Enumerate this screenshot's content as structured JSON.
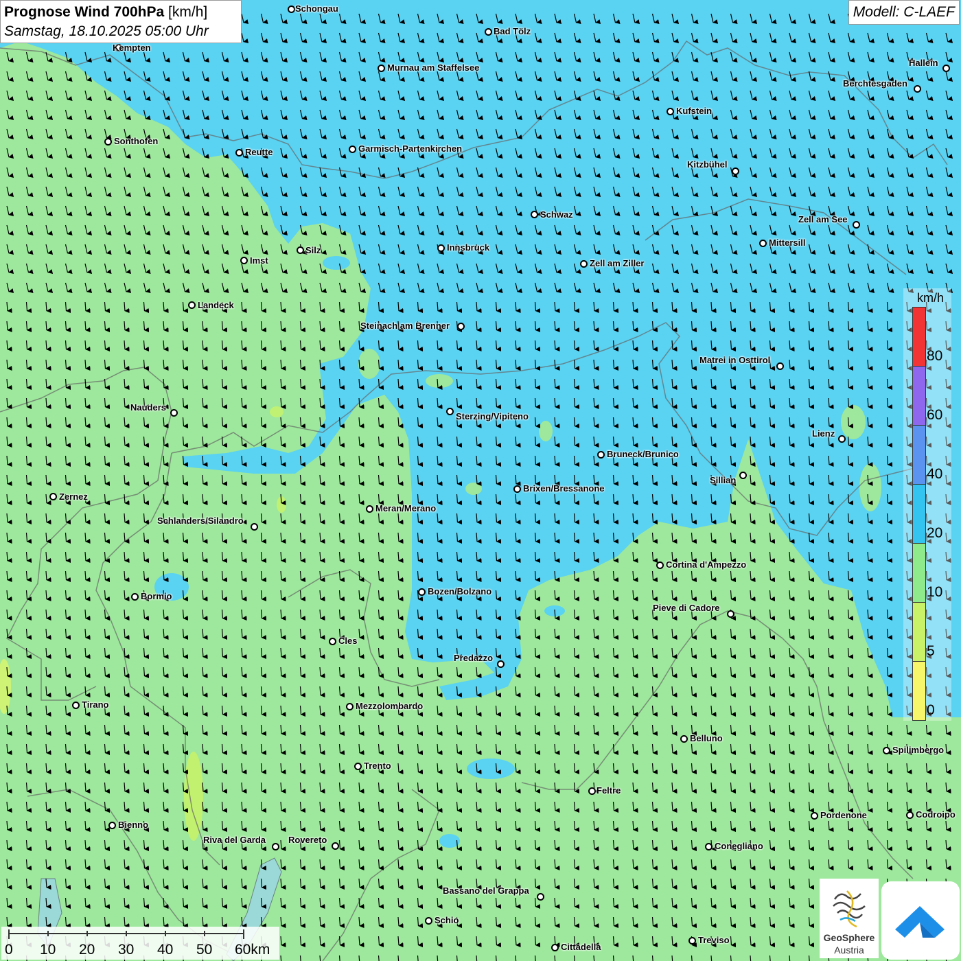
{
  "title": {
    "main": "Prognose Wind 700hPa",
    "unit": "[km/h]",
    "datetime": "Samstag, 18.10.2025 05:00 Uhr"
  },
  "model": "Modell: C-LAEF",
  "legend": {
    "unit": "km/h",
    "ticks": [
      "80",
      "60",
      "40",
      "20",
      "10",
      "5",
      "0"
    ],
    "bands": [
      {
        "from": 0,
        "to": 5,
        "color": "#f7f56a"
      },
      {
        "from": 5,
        "to": 10,
        "color": "#c9f268"
      },
      {
        "from": 10,
        "to": 20,
        "color": "#8fea8c"
      },
      {
        "from": 20,
        "to": 40,
        "color": "#33c4f0"
      },
      {
        "from": 40,
        "to": 60,
        "color": "#5a93f0"
      },
      {
        "from": 60,
        "to": 80,
        "color": "#8f66ee"
      },
      {
        "from": 80,
        "to": 100,
        "color": "#f23434"
      }
    ]
  },
  "scalebar": {
    "labels": [
      "0",
      "10",
      "20",
      "30",
      "40",
      "50",
      "60km"
    ]
  },
  "wind": {
    "direction": "north-to-south",
    "arrow_icon": "arrow-down-icon"
  },
  "cities": [
    {
      "name": "Schongau"
    },
    {
      "name": "Bad Tölz"
    },
    {
      "name": "Kempten"
    },
    {
      "name": "Murnau am Staffelsee"
    },
    {
      "name": "Hallein"
    },
    {
      "name": "Berchtesgaden"
    },
    {
      "name": "Kufstein"
    },
    {
      "name": "Sonthofen"
    },
    {
      "name": "Reutte"
    },
    {
      "name": "Garmisch-Partenkirchen"
    },
    {
      "name": "Kitzbühel"
    },
    {
      "name": "Schwaz"
    },
    {
      "name": "Zell am See"
    },
    {
      "name": "Mittersill"
    },
    {
      "name": "Silz"
    },
    {
      "name": "Innsbruck"
    },
    {
      "name": "Imst"
    },
    {
      "name": "Zell am Ziller"
    },
    {
      "name": "Landeck"
    },
    {
      "name": "Steinach am Brenner"
    },
    {
      "name": "Matrei in Osttirol"
    },
    {
      "name": "Nauders"
    },
    {
      "name": "Sterzing/Vipiteno"
    },
    {
      "name": "Lienz"
    },
    {
      "name": "Bruneck/Brunico"
    },
    {
      "name": "Sillian"
    },
    {
      "name": "Zernez"
    },
    {
      "name": "Brixen/Bressanone"
    },
    {
      "name": "Meran/Merano"
    },
    {
      "name": "Schlanders/Silandro"
    },
    {
      "name": "Cortina d'Ampezzo"
    },
    {
      "name": "Bozen/Bolzano"
    },
    {
      "name": "Bormio"
    },
    {
      "name": "Pieve di Cadore"
    },
    {
      "name": "Cles"
    },
    {
      "name": "Predazzo"
    },
    {
      "name": "Tirano"
    },
    {
      "name": "Mezzolombardo"
    },
    {
      "name": "Belluno"
    },
    {
      "name": "Spilimbergo"
    },
    {
      "name": "Trento"
    },
    {
      "name": "Feltre"
    },
    {
      "name": "Pordenone"
    },
    {
      "name": "Codroipo"
    },
    {
      "name": "Bienno"
    },
    {
      "name": "Riva del Garda"
    },
    {
      "name": "Rovereto"
    },
    {
      "name": "Conegliano"
    },
    {
      "name": "Bassano del Grappa"
    },
    {
      "name": "Schio"
    },
    {
      "name": "Treviso"
    },
    {
      "name": "Cittadella"
    }
  ],
  "logos": {
    "geosphere_name": "GeoSphere",
    "geosphere_sub": "Austria"
  }
}
